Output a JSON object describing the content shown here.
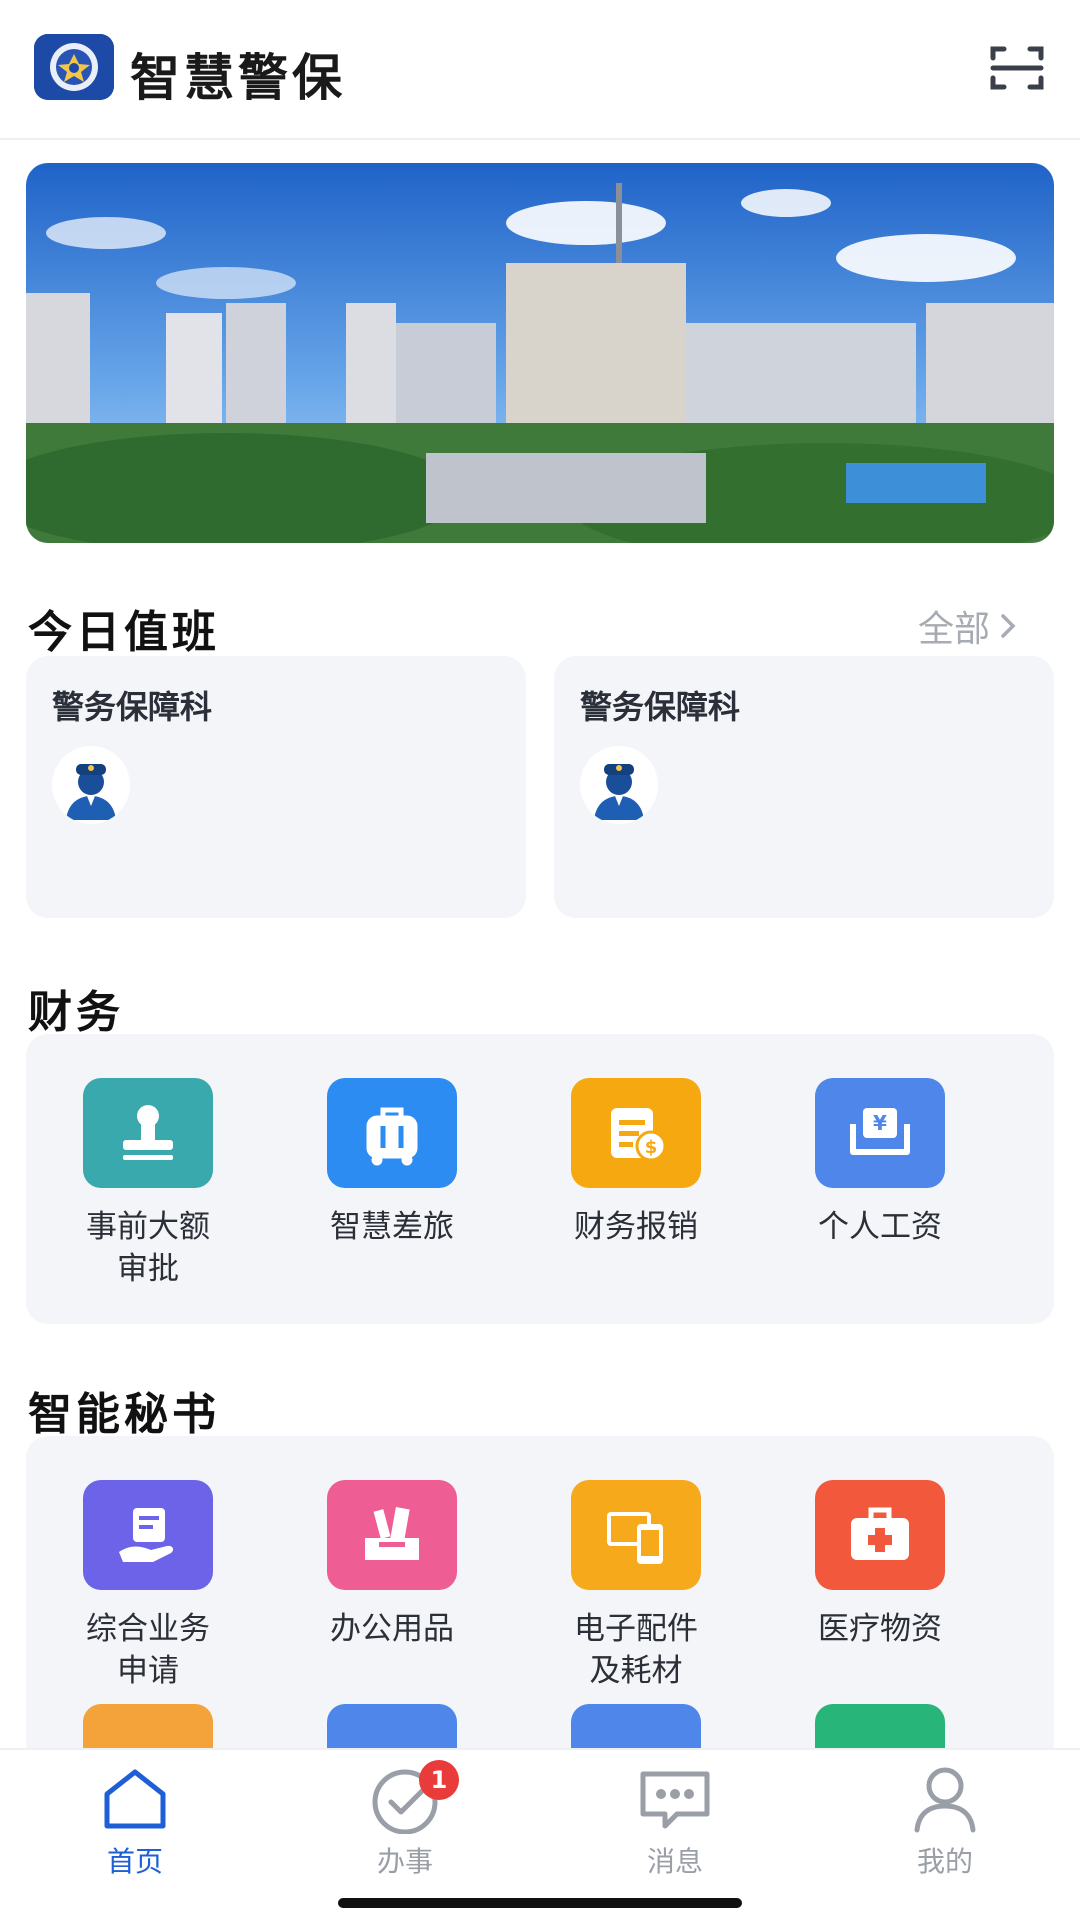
{
  "app": {
    "title": "智慧警保"
  },
  "duty": {
    "title": "今日值班",
    "see_all": "全部",
    "cards": [
      {
        "department": "警务保障科"
      },
      {
        "department": "警务保障科"
      }
    ]
  },
  "finance": {
    "title": "财务",
    "items": [
      {
        "label": "事前大额\n审批",
        "icon": "stamp-icon",
        "color": "#3aa9ad"
      },
      {
        "label": "智慧差旅",
        "icon": "luggage-icon",
        "color": "#2c8cf2"
      },
      {
        "label": "财务报销",
        "icon": "reimburse-receipt-icon",
        "color": "#f5a80f"
      },
      {
        "label": "个人工资",
        "icon": "salary-wallet-icon",
        "color": "#4f86ea"
      }
    ]
  },
  "secretary": {
    "title": "智能秘书",
    "items": [
      {
        "label": "综合业务\n申请",
        "icon": "hand-document-icon",
        "color": "#6d63e8"
      },
      {
        "label": "办公用品",
        "icon": "stationery-icon",
        "color": "#ee5d93"
      },
      {
        "label": "电子配件\n及耗材",
        "icon": "devices-icon",
        "color": "#f6a91a"
      },
      {
        "label": "医疗物资",
        "icon": "medical-kit-icon",
        "color": "#f1583c"
      }
    ],
    "partial_row_colors": [
      "#f4a23a",
      "#4f86ea",
      "#4f86ea",
      "#27b57a"
    ]
  },
  "nav": {
    "items": [
      {
        "label": "首页",
        "icon": "home-icon",
        "active": true
      },
      {
        "label": "办事",
        "icon": "task-check-icon",
        "badge": "1"
      },
      {
        "label": "消息",
        "icon": "message-icon"
      },
      {
        "label": "我的",
        "icon": "user-icon"
      }
    ]
  },
  "colors": {
    "accent": "#1d5fd6",
    "badge": "#ea3b3b",
    "panel_bg": "#f4f5f8"
  }
}
